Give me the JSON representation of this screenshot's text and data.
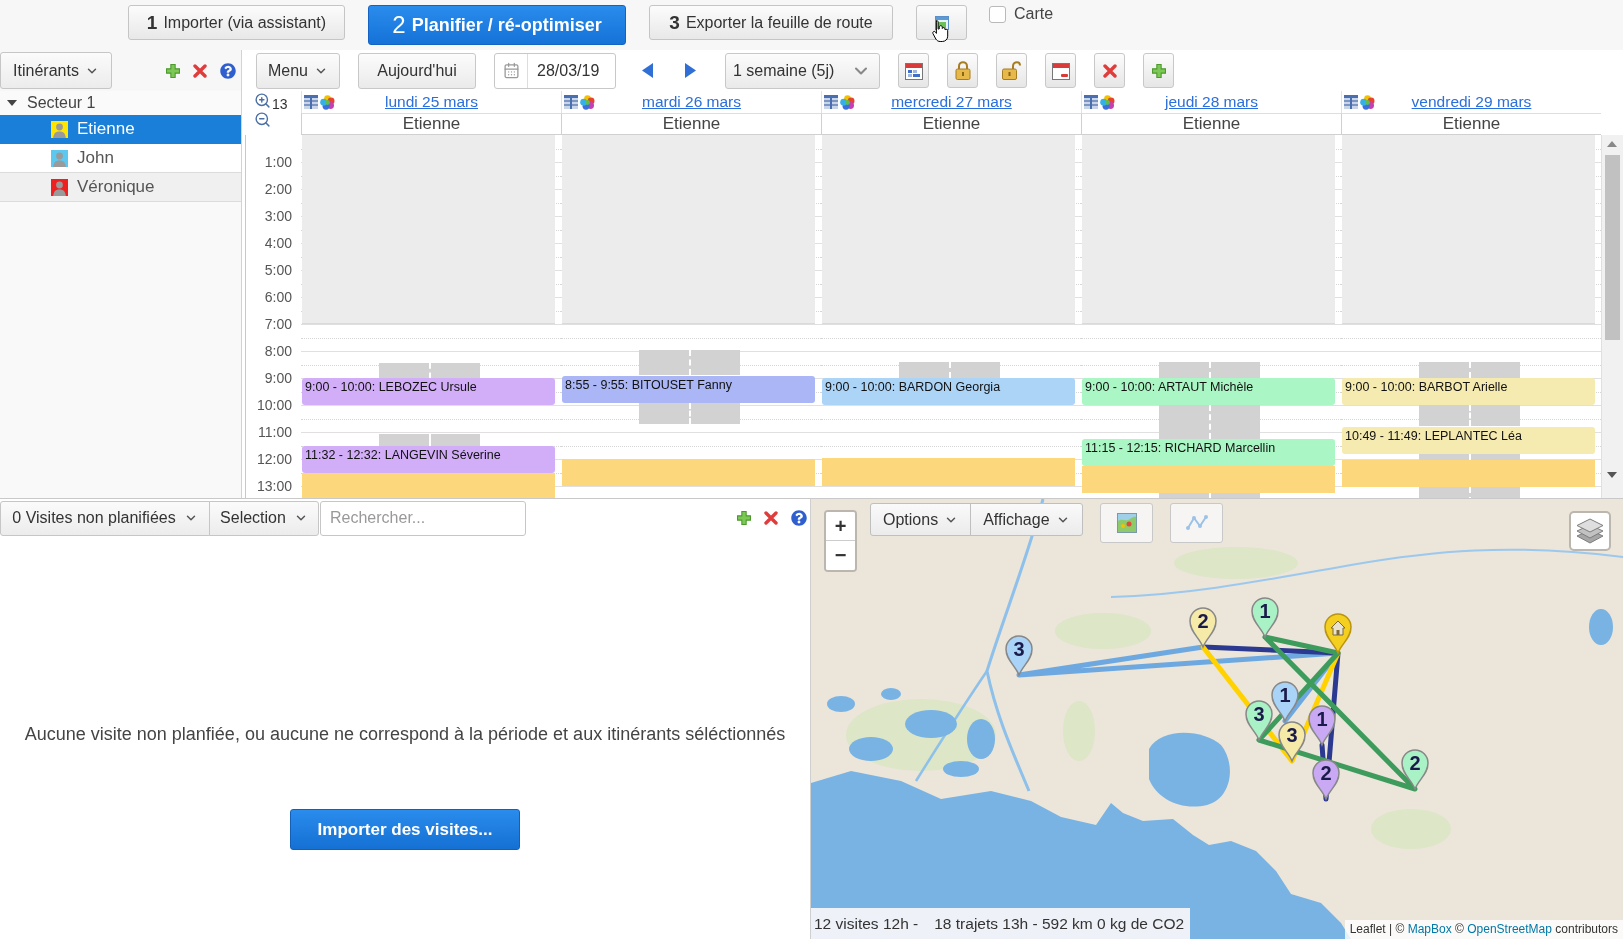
{
  "top_bar": {
    "steps": [
      {
        "number": "1",
        "label": "Importer (via assistant)",
        "selected": false
      },
      {
        "number": "2",
        "label": "Planifier / ré-optimiser",
        "selected": true
      },
      {
        "number": "3",
        "label": "Exporter la feuille de route",
        "selected": false
      }
    ],
    "map_toggle": {
      "label": "Carte",
      "checked": false
    }
  },
  "sidebar": {
    "dropdown": "Itinérants",
    "tree": [
      {
        "label": "Secteur 1",
        "expanded": true,
        "children": [
          {
            "label": "Etienne",
            "selected": true,
            "color": "#ffe600"
          },
          {
            "label": "John",
            "selected": false,
            "color": "#5cc8f0"
          },
          {
            "label": "Véronique",
            "selected": false,
            "color": "#ee2020"
          }
        ]
      }
    ]
  },
  "calendar": {
    "toolbar": {
      "menu": "Menu",
      "today": "Aujourd'hui",
      "date": "28/03/19",
      "range": "1 semaine (5j)"
    },
    "zoom_level": "13",
    "hours": [
      "1:00",
      "2:00",
      "3:00",
      "4:00",
      "5:00",
      "6:00",
      "7:00",
      "8:00",
      "9:00",
      "10:00",
      "11:00",
      "12:00",
      "13:00"
    ],
    "days": [
      {
        "label": "lundi 25 mars",
        "resource": "Etienne",
        "events": [
          {
            "kind": "travel"
          },
          {
            "kind": "visit",
            "label": "9:00 - 10:00: LEBOZEC Ursule",
            "color": "#d3aef8"
          },
          {
            "kind": "travel"
          },
          {
            "kind": "visit",
            "label": "11:32 - 12:32: LANGEVIN Séverine",
            "color": "#d3aef8"
          },
          {
            "kind": "break"
          }
        ]
      },
      {
        "label": "mardi 26 mars",
        "resource": "Etienne",
        "events": [
          {
            "kind": "travel"
          },
          {
            "kind": "visit",
            "label": "8:55 - 9:55: BITOUSET Fanny",
            "color": "#aab6f6"
          },
          {
            "kind": "travel"
          },
          {
            "kind": "break"
          }
        ]
      },
      {
        "label": "mercredi 27 mars",
        "resource": "Etienne",
        "events": [
          {
            "kind": "travel"
          },
          {
            "kind": "visit",
            "label": "9:00 - 10:00: BARDON Georgia",
            "color": "#acd4f7"
          },
          {
            "kind": "break"
          }
        ]
      },
      {
        "label": "jeudi 28 mars",
        "resource": "Etienne",
        "events": [
          {
            "kind": "travel"
          },
          {
            "kind": "visit",
            "label": "9:00 - 10:00: ARTAUT Michèle",
            "color": "#aaf6c4"
          },
          {
            "kind": "travel"
          },
          {
            "kind": "visit",
            "label": "11:15 - 12:15: RICHARD Marcellin",
            "color": "#aaf6c4"
          },
          {
            "kind": "break"
          },
          {
            "kind": "travel"
          }
        ]
      },
      {
        "label": "vendredi 29 mars",
        "resource": "Etienne",
        "events": [
          {
            "kind": "travel"
          },
          {
            "kind": "visit",
            "label": "9:00 - 10:00: BARBOT Arielle",
            "color": "#f5eab0"
          },
          {
            "kind": "travel"
          },
          {
            "kind": "visit",
            "label": "10:49 - 11:49: LEPLANTEC Léa",
            "color": "#f5eab0"
          },
          {
            "kind": "travel"
          },
          {
            "kind": "break"
          },
          {
            "kind": "travel"
          }
        ]
      }
    ]
  },
  "unplanned": {
    "dropdown": "0 Visites non planifiées",
    "selection": "Selection",
    "search": {
      "placeholder": "Rechercher..."
    },
    "message": "Aucune visite non planfiée, ou aucune ne correspond à la période et aux itinérants séléctionnés",
    "import_button": "Importer des visites..."
  },
  "map": {
    "zoom_in": "+",
    "zoom_out": "−",
    "options": "Options",
    "display": "Affichage",
    "routes": [
      {
        "color": "#6ea8e0"
      },
      {
        "color": "#2b3990"
      },
      {
        "color": "#ffd200"
      },
      {
        "color": "#3d9b5c"
      }
    ],
    "markers": [
      {
        "kind": "numbered",
        "label": "1",
        "color": "#a9f2c5"
      },
      {
        "kind": "numbered",
        "label": "2",
        "color": "#f6eaa8"
      },
      {
        "kind": "home"
      },
      {
        "kind": "numbered",
        "label": "3",
        "color": "#a9d3f7"
      },
      {
        "kind": "numbered",
        "label": "1",
        "color": "#a9d3f7"
      },
      {
        "kind": "numbered",
        "label": "3",
        "color": "#a9f2c5"
      },
      {
        "kind": "numbered",
        "label": "1",
        "color": "#c9a9f3"
      },
      {
        "kind": "numbered",
        "label": "3",
        "color": "#f6eaa8"
      },
      {
        "kind": "numbered",
        "label": "2",
        "color": "#a9f2c5"
      },
      {
        "kind": "numbered",
        "label": "2",
        "color": "#c9a9f3"
      }
    ],
    "summary": [
      "12 visites 12h -",
      "18 trajets 13h - 592 km 0 kg de CO2"
    ],
    "attribution": [
      {
        "kind": "text",
        "text": "Leaflet | ©"
      },
      {
        "kind": "link",
        "text": "MapBox"
      },
      {
        "kind": "text",
        "text": "©"
      },
      {
        "kind": "link",
        "text": "OpenStreetMap"
      },
      {
        "kind": "text",
        "text": "contributors"
      }
    ]
  }
}
